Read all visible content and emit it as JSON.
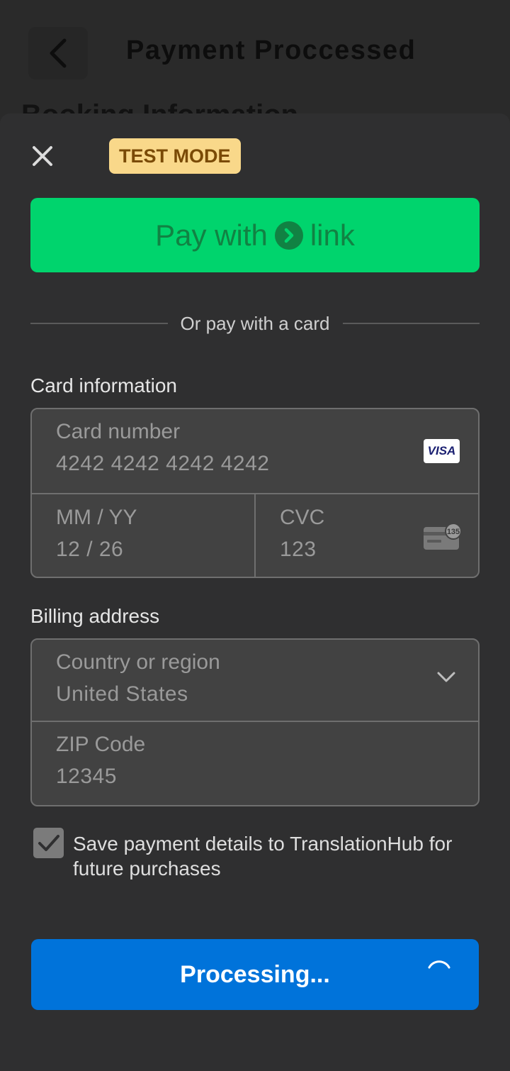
{
  "background": {
    "title": "Payment Proccessed",
    "subtitle": "Booking Information"
  },
  "sheet": {
    "badge": "TEST MODE",
    "link_button": {
      "prefix": "Pay with",
      "brand": "link"
    },
    "divider_text": "Or pay with a card",
    "card_section": {
      "label": "Card information",
      "card_number_label": "Card number",
      "card_number_value": "4242 4242 4242 4242",
      "card_brand": "VISA",
      "expiry_label": "MM / YY",
      "expiry_value": "12 / 26",
      "cvc_label": "CVC",
      "cvc_value": "123",
      "cvc_icon_text": "135"
    },
    "billing_section": {
      "label": "Billing address",
      "country_label": "Country or region",
      "country_value": "United States",
      "zip_label": "ZIP Code",
      "zip_value": "12345"
    },
    "save_checkbox": {
      "checked": true,
      "text": "Save payment details to TranslationHub for future purchases"
    },
    "pay_button": {
      "label": "Processing..."
    }
  },
  "colors": {
    "link_green": "#00d46d",
    "primary_blue": "#0073da",
    "badge_bg": "#f9d88a"
  }
}
